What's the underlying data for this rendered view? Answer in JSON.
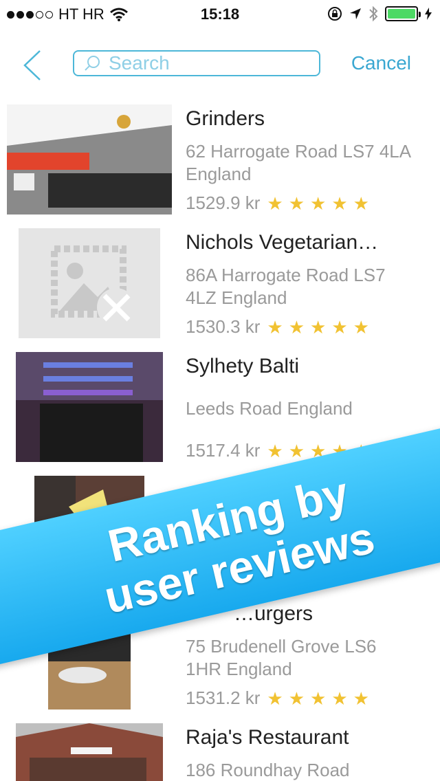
{
  "status_bar": {
    "carrier": "HT HR",
    "time": "15:18",
    "signal_dots_filled": 3,
    "battery_level": 1.0
  },
  "nav": {
    "back_icon": "chevron-left-icon",
    "search_placeholder": "Search",
    "cancel_label": "Cancel"
  },
  "colors": {
    "accent": "#3aa7d1",
    "star": "#f1c232",
    "banner": "#1fb1f2"
  },
  "restaurants": [
    {
      "name": "Grinders",
      "address": "62 Harrogate Road  LS7 4LA England",
      "price": "1529.9 kr",
      "stars": 5
    },
    {
      "name": "Nichols Vegetarian…",
      "address": "86A Harrogate Road LS7 4LZ England",
      "price": "1530.3 kr",
      "stars": 5
    },
    {
      "name": "Sylhety Balti",
      "address": "Leeds Road   England",
      "price": "1517.4 kr",
      "stars": 5
    },
    {
      "name": "",
      "address": "",
      "price": "",
      "stars": 5
    },
    {
      "name": "…urgers",
      "address": "75 Brudenell Grove  LS6 1HR England",
      "price": "1531.2 kr",
      "stars": 5
    },
    {
      "name": "Raja's Restaurant",
      "address": "186 Roundhay Road",
      "price": "",
      "stars": 0
    }
  ],
  "banner": {
    "line1": "Ranking by",
    "line2": "user reviews"
  }
}
